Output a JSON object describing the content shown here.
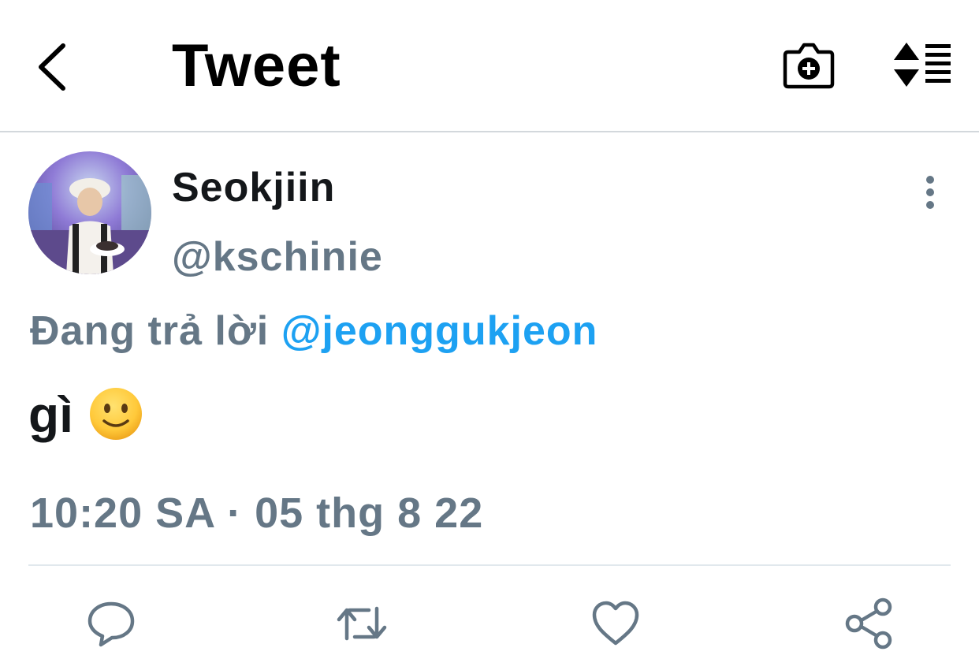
{
  "header": {
    "title": "Tweet",
    "back_icon": "chevron-left-icon",
    "camera_icon": "camera-plus-icon",
    "sort_icon": "sort-list-icon"
  },
  "tweet": {
    "author": {
      "display_name": "Seokjiin",
      "handle": "@kschinie"
    },
    "reply_context": {
      "prefix": "Đang trả lời",
      "mention": "@jeonggukjeon"
    },
    "text": "gì",
    "emoji": "slightly-smiling-face",
    "timestamp": "10:20 SA · 05 thg 8 22"
  },
  "actions": {
    "reply_icon": "reply-icon",
    "retweet_icon": "retweet-icon",
    "like_icon": "heart-icon",
    "share_icon": "share-icon"
  },
  "colors": {
    "accent": "#1da1f2",
    "secondary_text": "#657786",
    "primary_text": "#14171a",
    "divider": "#e1e8ed"
  }
}
